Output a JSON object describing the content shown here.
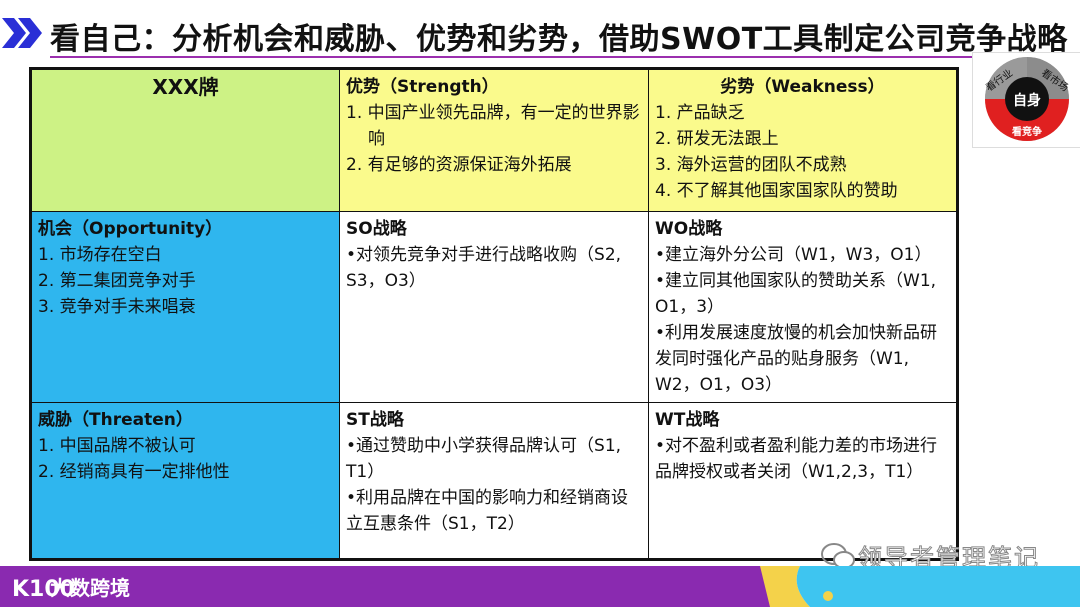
{
  "title": "看自己：分析机会和威胁、优势和劣势，借助SWOT工具制定公司竞争战略",
  "corner": {
    "label": "XXX牌"
  },
  "strength": {
    "title": "优势（Strength）",
    "items": [
      "1. 中国产业领先品牌，有一定的世界影响",
      "2. 有足够的资源保证海外拓展"
    ]
  },
  "weakness": {
    "title": "劣势（Weakness）",
    "items": [
      "1. 产品缺乏",
      "2. 研发无法跟上",
      "3. 海外运营的团队不成熟",
      "4. 不了解其他国家国家队的赞助"
    ]
  },
  "opportunity": {
    "title": "机会（Opportunity）",
    "items": [
      "1. 市场存在空白",
      "2. 第二集团竞争对手",
      "3. 竞争对手未来唱衰"
    ]
  },
  "threat": {
    "title": "威胁（Threaten）",
    "items": [
      "1. 中国品牌不被认可",
      "2. 经销商具有一定排他性"
    ]
  },
  "so": {
    "title": "SO战略",
    "items": [
      "•对领先竞争对手进行战略收购（S2, S3，O3）"
    ]
  },
  "wo": {
    "title": "WO战略",
    "items": [
      "•建立海外分公司（W1，W3，O1）",
      "•建立同其他国家队的赞助关系（W1, O1，3）",
      "•利用发展速度放慢的机会加快新品研发同时强化产品的贴身服务（W1, W2，O1，O3）"
    ]
  },
  "st": {
    "title": "ST战略",
    "items": [
      "•通过赞助中小学获得品牌认可（S1, T1）",
      "•利用品牌在中国的影响力和经销商设立互惠条件（S1，T2）"
    ]
  },
  "wt": {
    "title": "WT战略",
    "items": [
      "•对不盈利或者盈利能力差的市场进行品牌授权或者关闭（W1,2,3，T1）"
    ]
  },
  "logo_badge": {
    "center": "自身",
    "top_left": "看行业",
    "top_right": "看市场",
    "bottom": "看竞争"
  },
  "footer": {
    "brand": "大数跨境",
    "brand_mark": "K100",
    "watermark": "领导者管理笔记"
  },
  "colors": {
    "accent": "#9b2fae",
    "yellow": "#fafa8c",
    "green": "#cdf285",
    "blue": "#2fb6ee"
  }
}
